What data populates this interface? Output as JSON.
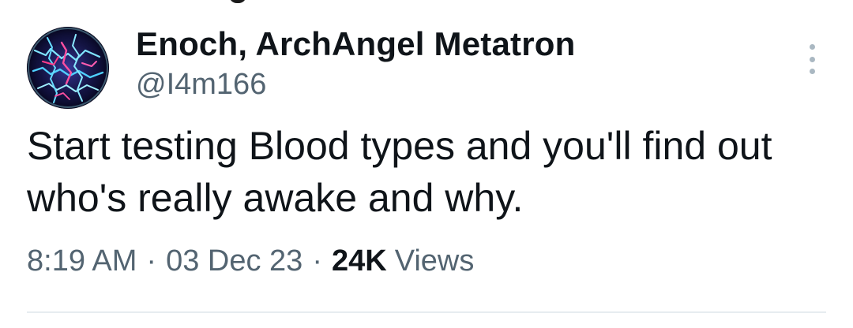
{
  "tweet": {
    "display_name": "Enoch, ArchAngel Metatron",
    "handle": "@I4m166",
    "text": "Start testing Blood types and you'll find out who's really awake and why.",
    "time": "8:19 AM",
    "date": "03 Dec 23",
    "separator": "·",
    "views_count": "24K",
    "views_label": "Views"
  },
  "icons": {
    "avatar": "plasma-globe-avatar",
    "more": "more-vertical-icon"
  },
  "colors": {
    "text_primary": "#0f1419",
    "text_secondary": "#536471",
    "more_dots": "#aab8c2",
    "divider": "#e7ecf0"
  }
}
